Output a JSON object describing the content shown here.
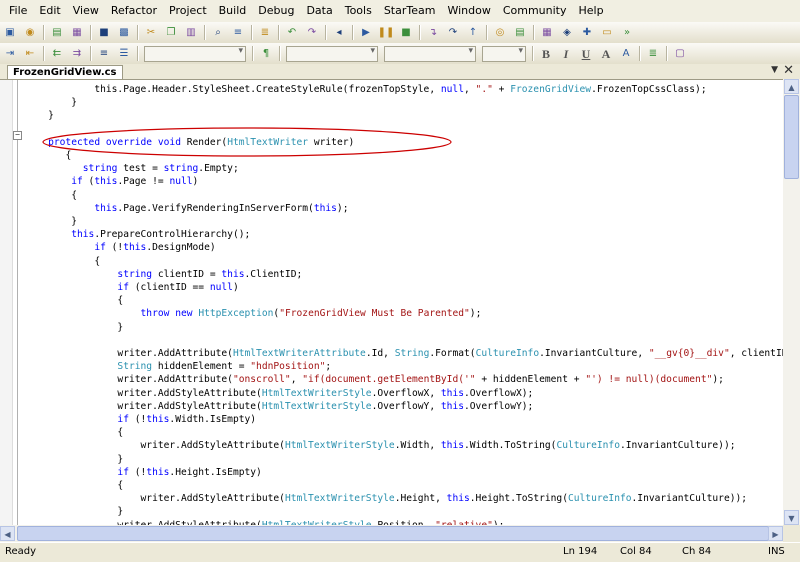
{
  "menu": [
    "File",
    "Edit",
    "View",
    "Refactor",
    "Project",
    "Build",
    "Debug",
    "Data",
    "Tools",
    "StarTeam",
    "Window",
    "Community",
    "Help"
  ],
  "toolbar": {
    "row1_icons": [
      "new-project-icon",
      "add-item-icon",
      "open-file-icon",
      "add-icon",
      "save-icon",
      "save-all-icon",
      "cut-icon",
      "copy-icon",
      "paste-icon",
      "find-icon",
      "comment-icon",
      "uncomment-icon",
      "undo-icon",
      "redo-icon",
      "navigate-back-icon",
      "start-debugging-icon",
      "break-icon",
      "stop-icon",
      "step-into-icon",
      "step-over-icon",
      "step-out-icon",
      "watch-icon",
      "solution-explorer-icon",
      "properties-icon",
      "object-browser-icon",
      "toolbox-icon",
      "start-page-icon",
      "more-icon"
    ],
    "format_buttons": [
      "B",
      "I",
      "U",
      "A"
    ],
    "row2_icons": [
      "indent-icon",
      "outdent-icon",
      "decrease-indent-icon",
      "increase-indent-icon",
      "align-left-icon",
      "align-center-icon",
      "align-right-icon",
      "style-icon",
      "bullets-icon",
      "numbering-icon",
      "font-color-icon",
      "highlight-icon",
      "justify-icon",
      "borders-icon"
    ]
  },
  "document_tab": {
    "label": "FrozenGridView.cs"
  },
  "code_lines": [
    {
      "indent": "            ",
      "tokens": [
        {
          "t": "this.Page.Header.StyleSheet.CreateStyleRule(frozenTopStyle, "
        },
        {
          "t": "null",
          "c": "kw"
        },
        {
          "t": ", "
        },
        {
          "t": "\".\"",
          "c": "st"
        },
        {
          "t": " + "
        },
        {
          "t": "FrozenGridView",
          "c": "ty"
        },
        {
          "t": ".FrozenTopCssClass);"
        }
      ]
    },
    {
      "indent": "        ",
      "tokens": [
        {
          "t": "}"
        }
      ]
    },
    {
      "indent": "    ",
      "tokens": [
        {
          "t": "}"
        }
      ]
    },
    {
      "indent": "",
      "tokens": []
    },
    {
      "indent": "    ",
      "tokens": [
        {
          "t": "protected",
          "c": "kw"
        },
        {
          "t": " "
        },
        {
          "t": "override",
          "c": "kw"
        },
        {
          "t": " "
        },
        {
          "t": "void",
          "c": "kw"
        },
        {
          "t": " Render("
        },
        {
          "t": "HtmlTextWriter",
          "c": "ty"
        },
        {
          "t": " writer)"
        }
      ]
    },
    {
      "indent": "       ",
      "tokens": [
        {
          "t": "{"
        }
      ]
    },
    {
      "indent": "          ",
      "tokens": [
        {
          "t": "string",
          "c": "kw"
        },
        {
          "t": " test = "
        },
        {
          "t": "string",
          "c": "kw"
        },
        {
          "t": ".Empty;"
        }
      ]
    },
    {
      "indent": "        ",
      "tokens": [
        {
          "t": "if",
          "c": "kw"
        },
        {
          "t": " ("
        },
        {
          "t": "this",
          "c": "kw"
        },
        {
          "t": ".Page != "
        },
        {
          "t": "null",
          "c": "kw"
        },
        {
          "t": ")"
        }
      ]
    },
    {
      "indent": "        ",
      "tokens": [
        {
          "t": "{"
        }
      ]
    },
    {
      "indent": "            ",
      "tokens": [
        {
          "t": "this",
          "c": "kw"
        },
        {
          "t": ".Page.VerifyRenderingInServerForm("
        },
        {
          "t": "this",
          "c": "kw"
        },
        {
          "t": ");"
        }
      ]
    },
    {
      "indent": "        ",
      "tokens": [
        {
          "t": "}"
        }
      ]
    },
    {
      "indent": "        ",
      "tokens": [
        {
          "t": "this",
          "c": "kw"
        },
        {
          "t": ".PrepareControlHierarchy();"
        }
      ]
    },
    {
      "indent": "            ",
      "tokens": [
        {
          "t": "if",
          "c": "kw"
        },
        {
          "t": " (!"
        },
        {
          "t": "this",
          "c": "kw"
        },
        {
          "t": ".DesignMode)"
        }
      ]
    },
    {
      "indent": "            ",
      "tokens": [
        {
          "t": "{"
        }
      ]
    },
    {
      "indent": "                ",
      "tokens": [
        {
          "t": "string",
          "c": "kw"
        },
        {
          "t": " clientID = "
        },
        {
          "t": "this",
          "c": "kw"
        },
        {
          "t": ".ClientID;"
        }
      ]
    },
    {
      "indent": "                ",
      "tokens": [
        {
          "t": "if",
          "c": "kw"
        },
        {
          "t": " (clientID == "
        },
        {
          "t": "null",
          "c": "kw"
        },
        {
          "t": ")"
        }
      ]
    },
    {
      "indent": "                ",
      "tokens": [
        {
          "t": "{"
        }
      ]
    },
    {
      "indent": "                    ",
      "tokens": [
        {
          "t": "throw",
          "c": "kw"
        },
        {
          "t": " "
        },
        {
          "t": "new",
          "c": "kw"
        },
        {
          "t": " "
        },
        {
          "t": "HttpException",
          "c": "ty"
        },
        {
          "t": "("
        },
        {
          "t": "\"FrozenGridView Must Be Parented\"",
          "c": "st"
        },
        {
          "t": ");"
        }
      ]
    },
    {
      "indent": "                ",
      "tokens": [
        {
          "t": "}"
        }
      ]
    },
    {
      "indent": "",
      "tokens": []
    },
    {
      "indent": "                ",
      "tokens": [
        {
          "t": "writer.AddAttribute("
        },
        {
          "t": "HtmlTextWriterAttribute",
          "c": "ty"
        },
        {
          "t": ".Id, "
        },
        {
          "t": "String",
          "c": "ty"
        },
        {
          "t": ".Format("
        },
        {
          "t": "CultureInfo",
          "c": "ty"
        },
        {
          "t": ".InvariantCulture, "
        },
        {
          "t": "\"__gv{0}__div\"",
          "c": "st"
        },
        {
          "t": ", clientID));"
        }
      ]
    },
    {
      "indent": "                ",
      "tokens": [
        {
          "t": "String",
          "c": "ty"
        },
        {
          "t": " hiddenElement = "
        },
        {
          "t": "\"hdnPosition\"",
          "c": "st"
        },
        {
          "t": ";"
        }
      ]
    },
    {
      "indent": "                ",
      "tokens": [
        {
          "t": "writer.AddAttribute("
        },
        {
          "t": "\"onscroll\"",
          "c": "st"
        },
        {
          "t": ", "
        },
        {
          "t": "\"if(document.getElementById('\"",
          "c": "st"
        },
        {
          "t": " + hiddenElement + "
        },
        {
          "t": "\"') != null)(document\"",
          "c": "st"
        },
        {
          "t": ");"
        }
      ]
    },
    {
      "indent": "                ",
      "tokens": [
        {
          "t": "writer.AddStyleAttribute("
        },
        {
          "t": "HtmlTextWriterStyle",
          "c": "ty"
        },
        {
          "t": ".OverflowX, "
        },
        {
          "t": "this",
          "c": "kw"
        },
        {
          "t": ".OverflowX);"
        }
      ]
    },
    {
      "indent": "                ",
      "tokens": [
        {
          "t": "writer.AddStyleAttribute("
        },
        {
          "t": "HtmlTextWriterStyle",
          "c": "ty"
        },
        {
          "t": ".OverflowY, "
        },
        {
          "t": "this",
          "c": "kw"
        },
        {
          "t": ".OverflowY);"
        }
      ]
    },
    {
      "indent": "                ",
      "tokens": [
        {
          "t": "if",
          "c": "kw"
        },
        {
          "t": " (!"
        },
        {
          "t": "this",
          "c": "kw"
        },
        {
          "t": ".Width.IsEmpty)"
        }
      ]
    },
    {
      "indent": "                ",
      "tokens": [
        {
          "t": "{"
        }
      ]
    },
    {
      "indent": "                    ",
      "tokens": [
        {
          "t": "writer.AddStyleAttribute("
        },
        {
          "t": "HtmlTextWriterStyle",
          "c": "ty"
        },
        {
          "t": ".Width, "
        },
        {
          "t": "this",
          "c": "kw"
        },
        {
          "t": ".Width.ToString("
        },
        {
          "t": "CultureInfo",
          "c": "ty"
        },
        {
          "t": ".InvariantCulture));"
        }
      ]
    },
    {
      "indent": "                ",
      "tokens": [
        {
          "t": "}"
        }
      ]
    },
    {
      "indent": "                ",
      "tokens": [
        {
          "t": "if",
          "c": "kw"
        },
        {
          "t": " (!"
        },
        {
          "t": "this",
          "c": "kw"
        },
        {
          "t": ".Height.IsEmpty)"
        }
      ]
    },
    {
      "indent": "                ",
      "tokens": [
        {
          "t": "{"
        }
      ]
    },
    {
      "indent": "                    ",
      "tokens": [
        {
          "t": "writer.AddStyleAttribute("
        },
        {
          "t": "HtmlTextWriterStyle",
          "c": "ty"
        },
        {
          "t": ".Height, "
        },
        {
          "t": "this",
          "c": "kw"
        },
        {
          "t": ".Height.ToString("
        },
        {
          "t": "CultureInfo",
          "c": "ty"
        },
        {
          "t": ".InvariantCulture));"
        }
      ]
    },
    {
      "indent": "                ",
      "tokens": [
        {
          "t": "}"
        }
      ]
    },
    {
      "indent": "                ",
      "tokens": [
        {
          "t": "writer.AddStyleAttribute("
        },
        {
          "t": "HtmlTextWriterStyle",
          "c": "ty"
        },
        {
          "t": ".Position, "
        },
        {
          "t": "\"relative\"",
          "c": "st"
        },
        {
          "t": ");"
        }
      ]
    }
  ],
  "status": {
    "ready": "Ready",
    "line": "Ln 194",
    "col": "Col 84",
    "ch": "Ch 84",
    "mode": "INS"
  },
  "colors": {
    "keyword": "#0000ff",
    "type": "#2b91af",
    "string": "#a31515",
    "annotation": "#cc0000"
  }
}
